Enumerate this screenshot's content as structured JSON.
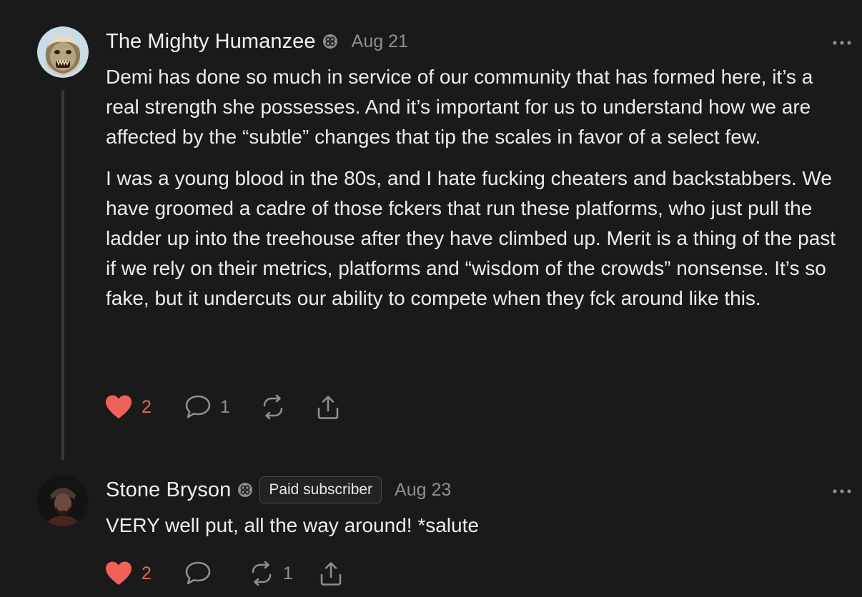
{
  "comments": [
    {
      "author": "The Mighty Humanzee",
      "verified_icon": "subscriber-icon",
      "date": "Aug 21",
      "paragraphs": [
        "Demi has done so much in service of our community that has formed here, it’s a real strength she possesses. And it’s important for us to understand how we are affected by the “subtle” changes that tip the scales in favor of a select few.",
        "I was a young blood in the 80s, and I hate fucking cheaters and backstabbers. We have groomed a cadre of those fckers that run these platforms, who just pull the ladder up into the treehouse after they have climbed up. Merit is a thing of the past if we rely on their metrics, platforms and “wisdom of the crowds” nonsense. It’s so fake, but it undercuts our ability to compete when they fck around like this."
      ],
      "likes": "2",
      "replies": "1",
      "restacks": "",
      "liked": true
    },
    {
      "author": "Stone Bryson",
      "verified_icon": "subscriber-icon",
      "badge": "Paid subscriber",
      "date": "Aug 23",
      "paragraphs": [
        "VERY well put, all the way around! *salute"
      ],
      "likes": "2",
      "replies": "",
      "restacks": "1",
      "liked": true
    }
  ],
  "colors": {
    "background": "#1a1a1b",
    "like": "#f0615a",
    "muted": "#8e8e93",
    "text": "#ececec"
  }
}
